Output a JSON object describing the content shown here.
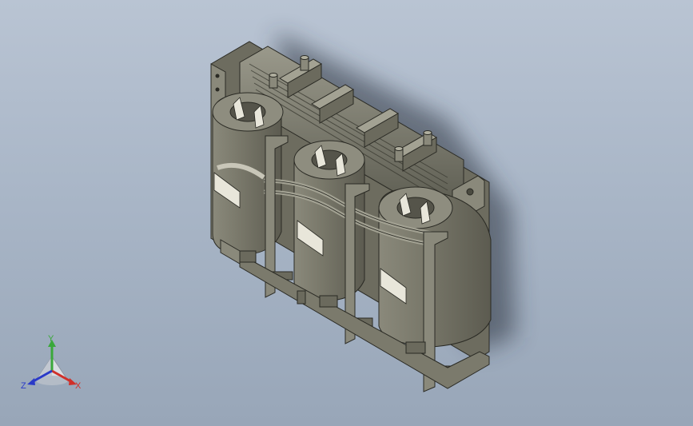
{
  "viewport": {
    "background_top": "#b9c4d3",
    "background_bottom": "#98a6b8",
    "part_color": "#7e7d6f",
    "part_shade": "#5f5e52",
    "part_light": "#a3a293",
    "edge_color": "#2a2a24",
    "shadow_color": "#2b313c"
  },
  "model": {
    "description_icon": "transformer-3d-model",
    "coil_count": 3
  },
  "triad": {
    "x_label": "X",
    "y_label": "Y",
    "z_label": "Z",
    "x_color": "#d0302a",
    "y_color": "#3aa83a",
    "z_color": "#2a3ac8"
  }
}
